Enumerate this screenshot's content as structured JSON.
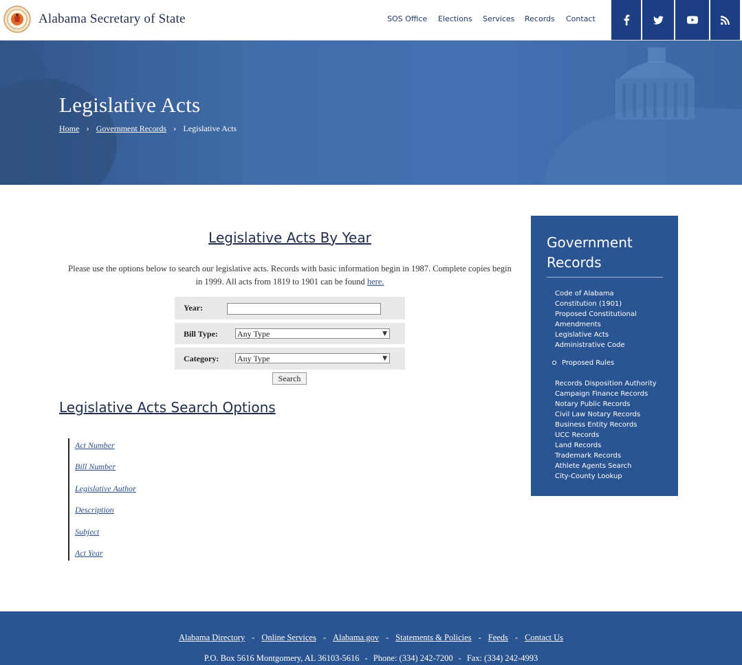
{
  "header": {
    "site_title": "Alabama Secretary of State",
    "nav": [
      "SOS Office",
      "Elections",
      "Services",
      "Records",
      "Contact"
    ],
    "social": [
      "facebook-icon",
      "twitter-icon",
      "youtube-icon",
      "rss-icon"
    ],
    "accent": "#1b3f82"
  },
  "hero": {
    "title": "Legislative Acts",
    "breadcrumb": [
      "Home",
      "Government Records",
      "Legislative Acts"
    ]
  },
  "main": {
    "heading": "Legislative Acts By Year",
    "intro_text": "Please use the options below to search our legislative acts. Records with basic information begin in 1987. Complete copies begin in 1999. All acts from 1819 to 1901 can be found ",
    "intro_link": "here.",
    "form": {
      "year_label": "Year:",
      "year_value": "",
      "bill_type_label": "Bill Type:",
      "bill_type_value": "Any Type",
      "category_label": "Category:",
      "category_value": "Any Type",
      "search_label": "Search"
    },
    "options_heading": "Legislative Acts Search Options",
    "options": [
      "Act Number",
      "Bill Number",
      "Legislative Author",
      "Description",
      "Subject",
      "Act Year"
    ]
  },
  "sidebar": {
    "title": "Government Records",
    "links_top": [
      "Code of Alabama",
      "Constitution (1901)",
      "Proposed Constitutional",
      "Amendments",
      "Legislative Acts",
      "Administrative Code"
    ],
    "sub_link": "Proposed Rules",
    "links_bottom": [
      "Records Disposition Authority",
      "Campaign Finance Records",
      "Notary Public Records",
      "Civil Law Notary Records",
      "Business Entity Records",
      "UCC Records",
      "Land Records",
      "Trademark Records",
      "Athlete Agents Search",
      "City-County Lookup"
    ]
  },
  "footer": {
    "links": [
      "Alabama Directory",
      "Online Services",
      "Alabama.gov",
      "Statements & Policies",
      "Feeds",
      "Contact Us"
    ],
    "address": "P.O. Box 5616 Montgomery, AL 36103-5616",
    "phone": "Phone: (334) 242-7200",
    "fax": "Fax: (334) 242-4993"
  }
}
